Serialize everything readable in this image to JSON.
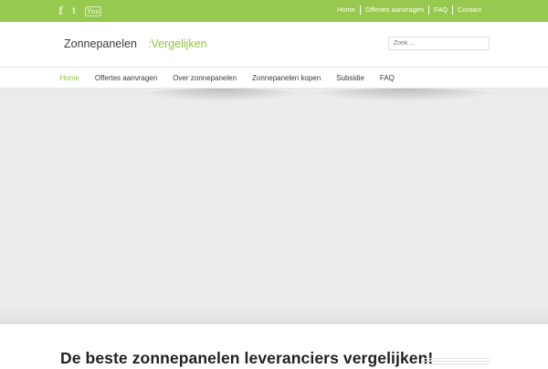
{
  "topbar": {
    "social": [
      {
        "name": "facebook-icon",
        "glyph": "f"
      },
      {
        "name": "twitter-icon",
        "glyph": "t"
      },
      {
        "name": "youtube-icon",
        "glyph": "You"
      }
    ],
    "links": [
      {
        "label": "Home"
      },
      {
        "label": "Offertes aanvragen"
      },
      {
        "label": "FAQ"
      },
      {
        "label": "Contact"
      }
    ],
    "bg_color": "#97c950"
  },
  "header": {
    "logo_part1": "Zonnepanelen",
    "logo_part2": ":Vergelijken",
    "search_placeholder": "Zoek ..."
  },
  "nav": {
    "items": [
      {
        "label": "Home",
        "active": true
      },
      {
        "label": "Offertes aanvragen",
        "active": false
      },
      {
        "label": "Over zonnepanelen",
        "active": false
      },
      {
        "label": "Zonnepanelen kopen",
        "active": false
      },
      {
        "label": "Subsidie",
        "active": false
      },
      {
        "label": "FAQ",
        "active": false
      }
    ],
    "active_color": "#8cc63f"
  },
  "main": {
    "heading": "De beste zonnepanelen leveranciers vergelijken!"
  }
}
